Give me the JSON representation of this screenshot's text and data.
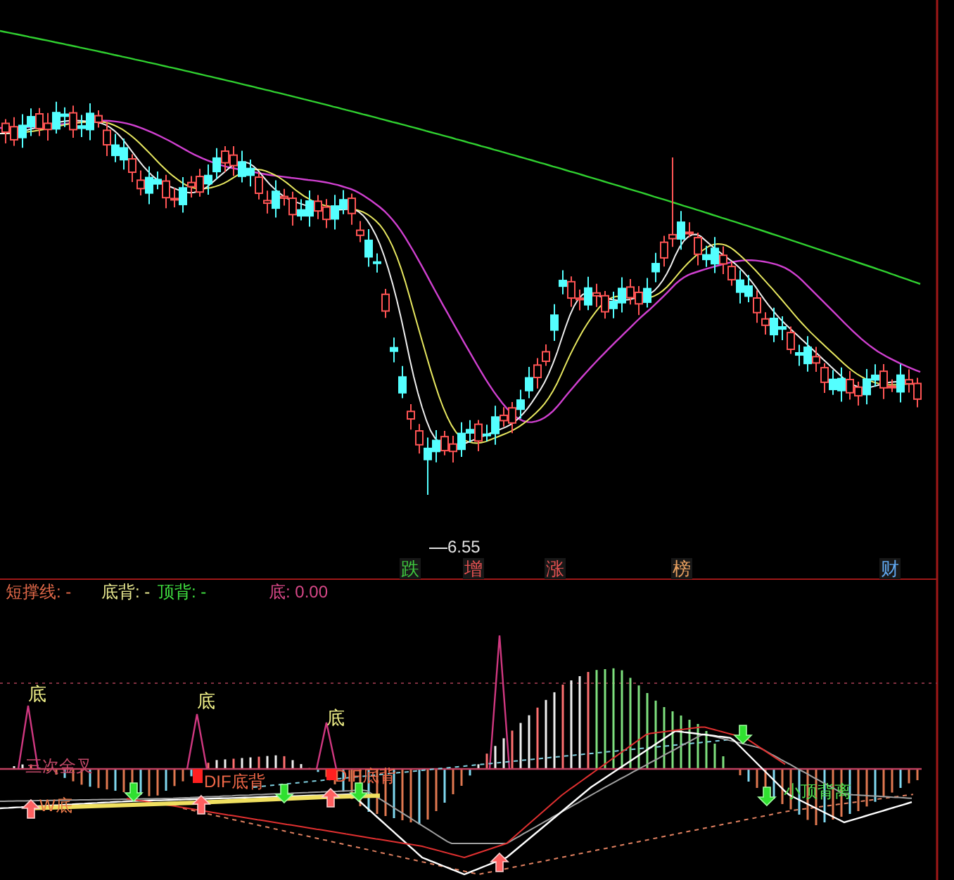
{
  "main_chart": {
    "low_label": "6.55",
    "event_markers": [
      {
        "text": "跌",
        "color": "#3fc83f"
      },
      {
        "text": "增",
        "color": "#e05050"
      },
      {
        "text": "涨",
        "color": "#e05050"
      },
      {
        "text": "榜",
        "color": "#e8a060"
      },
      {
        "text": "财",
        "color": "#60a8f0"
      }
    ]
  },
  "indicator_header": [
    {
      "text": "短撑线: -",
      "color": "#e06848"
    },
    {
      "text": "底背: -",
      "color": "#e8e890"
    },
    {
      "text": "顶背: -",
      "color": "#40e040"
    },
    {
      "text": "底: 0.00",
      "color": "#d84888"
    }
  ],
  "indicator_chart": {
    "labels": [
      {
        "text": "底",
        "kind": "peak"
      },
      {
        "text": "底",
        "kind": "peak"
      },
      {
        "text": "底",
        "kind": "peak"
      },
      {
        "text": "三次金叉",
        "kind": "cross"
      },
      {
        "text": "W底",
        "kind": "bottom"
      },
      {
        "text": "DIF底背",
        "kind": "divergence"
      },
      {
        "text": "DIF底背",
        "kind": "divergence"
      },
      {
        "text": "小顶背离",
        "kind": "top"
      }
    ]
  }
}
